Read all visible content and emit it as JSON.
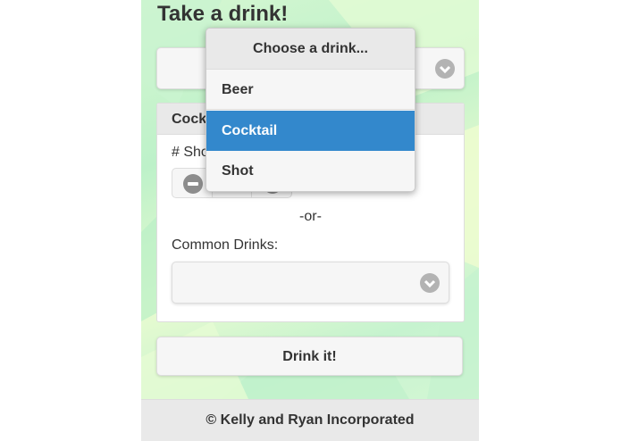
{
  "page": {
    "title": "Take a drink!",
    "footer": "© Kelly and Ryan Incorporated"
  },
  "drink_type_select": {
    "selected": "",
    "icon": "chevron-down-icon"
  },
  "panel": {
    "header": "Cock",
    "shots_label": "# Sho",
    "stepper": {
      "minus_icon": "minus-icon",
      "plus_icon": "plus-icon",
      "value": ""
    },
    "or_text": "-or-",
    "common_drinks_label": "Common Drinks:",
    "common_drinks_select": {
      "selected": "",
      "icon": "chevron-down-icon"
    }
  },
  "drink_button": "Drink it!",
  "dropdown": {
    "header": "Choose a drink...",
    "options": [
      "Beer",
      "Cocktail",
      "Shot"
    ],
    "selected": "Cocktail"
  },
  "colors": {
    "accent": "#3388cc",
    "background_green": "#c6f3cf"
  }
}
